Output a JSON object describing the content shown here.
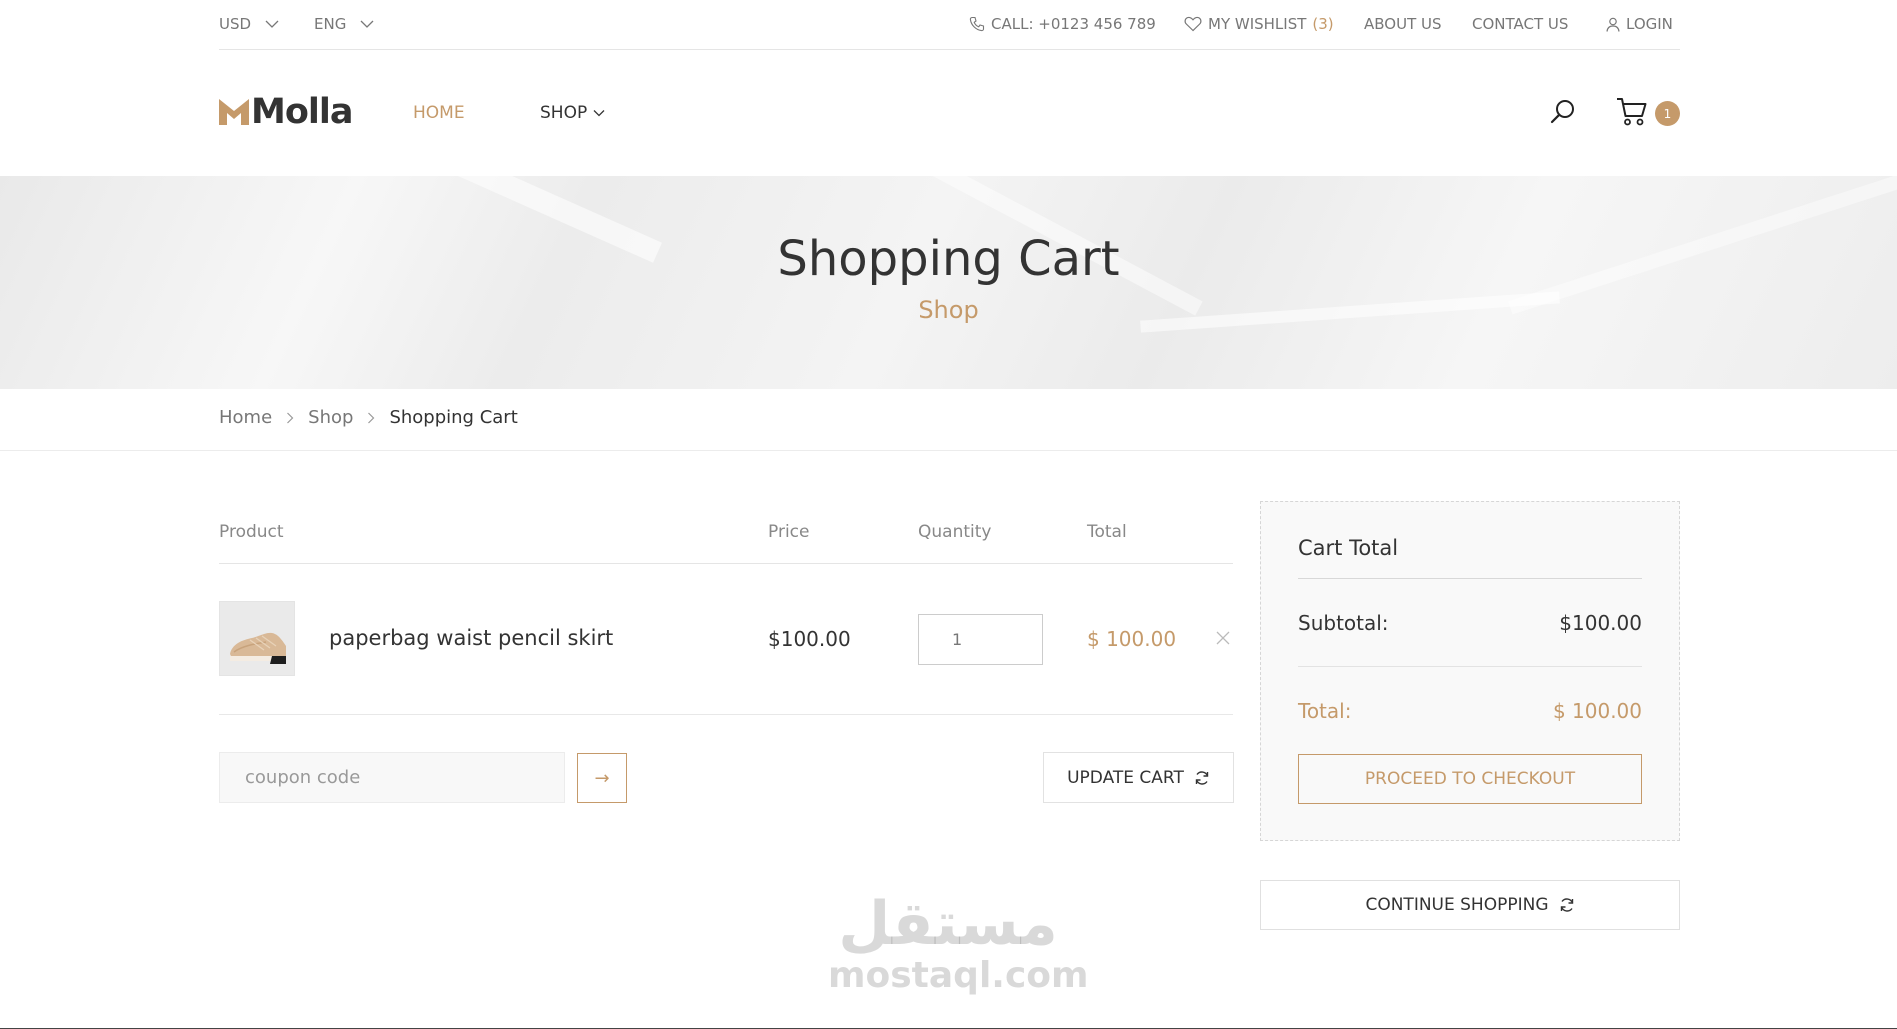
{
  "topbar": {
    "currency": "USD",
    "language": "ENG",
    "call": "CALL: +0123 456 789",
    "wishlist_label": "MY WISHLIST",
    "wishlist_count": "(3)",
    "about": "ABOUT US",
    "contact": "CONTACT US",
    "login": "LOGIN"
  },
  "header": {
    "logo_text": "Molla",
    "nav": {
      "home": "HOME",
      "shop": "SHOP"
    },
    "cart_count": "1"
  },
  "hero": {
    "title": "Shopping Cart",
    "subtitle": "Shop"
  },
  "breadcrumb": {
    "items": [
      "Home",
      "Shop"
    ],
    "current": "Shopping Cart"
  },
  "cart": {
    "columns": {
      "product": "Product",
      "price": "Price",
      "quantity": "Quantity",
      "total": "Total"
    },
    "items": [
      {
        "name": "paperbag waist pencil skirt",
        "price": "$100.00",
        "quantity": "1",
        "total": "$ 100.00"
      }
    ],
    "coupon_placeholder": "coupon code",
    "coupon_button": "→",
    "update_label": "UPDATE CART"
  },
  "totals": {
    "title": "Cart Total",
    "subtotal_label": "Subtotal:",
    "subtotal_value": "$100.00",
    "total_label": "Total:",
    "total_value": "$ 100.00",
    "checkout_label": "PROCEED TO CHECKOUT",
    "continue_label": "CONTINUE SHOPPING"
  },
  "watermark": {
    "arabic": "مستقل",
    "latin": "mostaql.com"
  },
  "colors": {
    "accent": "#c59a6a",
    "text": "#333333",
    "muted": "#777777"
  },
  "icons": [
    "chevron-down-icon",
    "phone-icon",
    "heart-icon",
    "user-icon",
    "search-icon",
    "cart-icon",
    "close-icon",
    "arrow-right-icon",
    "refresh-icon"
  ]
}
